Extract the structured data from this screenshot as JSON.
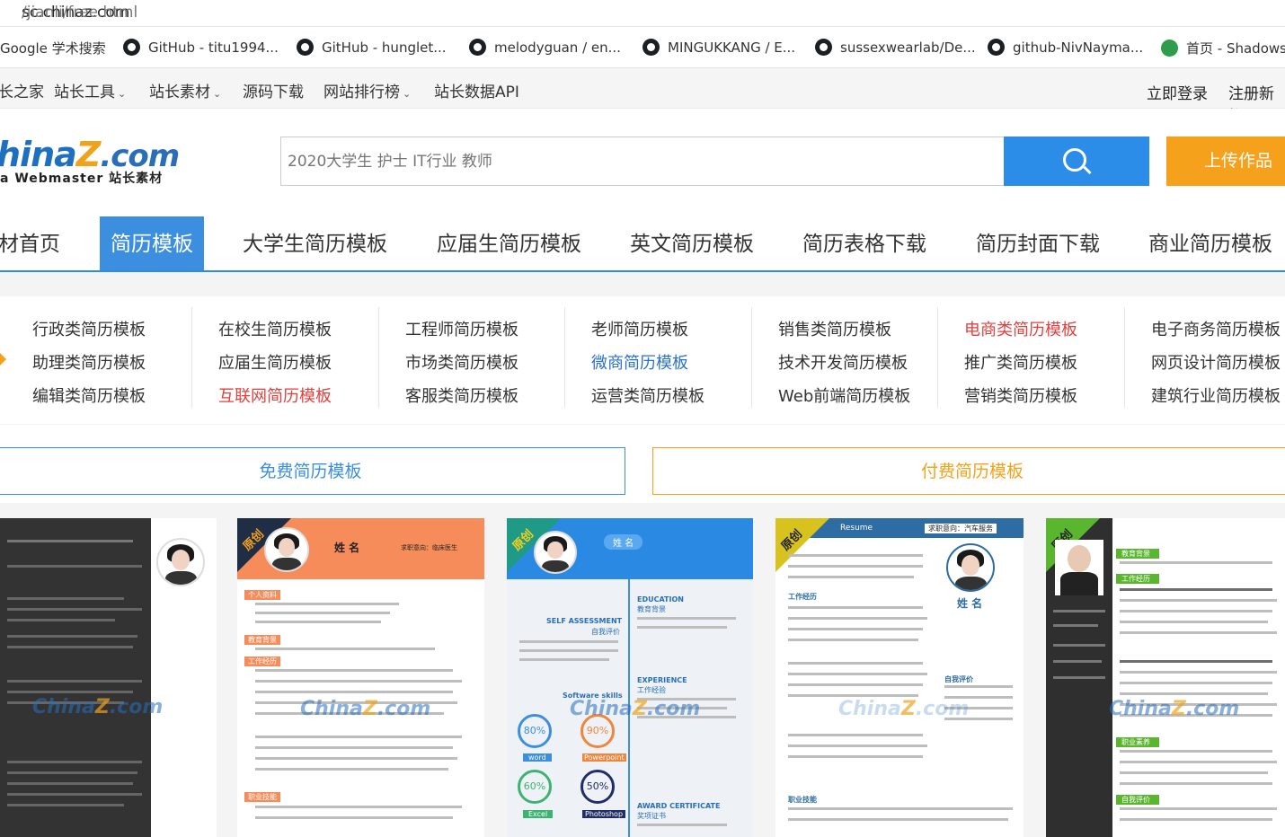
{
  "address": {
    "host": "sc.chinaz.com",
    "path": "/jianli/free.html"
  },
  "bookmarks": [
    "Google 学术搜索",
    "GitHub - titu1994...",
    "GitHub - hunglet...",
    "melodyguan / en...",
    "MINGUKKANG / E...",
    "sussexwearlab/De...",
    "github-NivNayma...",
    "首页 - Shadows"
  ],
  "topnav": {
    "items": [
      "长之家",
      "站长工具",
      "站长素材",
      "源码下载",
      "网站排行榜",
      "站长数据API"
    ],
    "login": "立即登录",
    "register": "注册新帐"
  },
  "logo": {
    "main_a": "hina",
    "main_z": "Z",
    "main_com": ".com",
    "sub": "a Webmaster 站长素材"
  },
  "search": {
    "placeholder": "2020大学生 护士 IT行业 教师",
    "upload": "上传作品"
  },
  "catnav": [
    "材首页",
    "简历模板",
    "大学生简历模板",
    "应届生简历模板",
    "英文简历模板",
    "简历表格下载",
    "简历封面下载",
    "商业简历模板"
  ],
  "subcats": [
    [
      "行政类简历模板",
      "助理类简历模板",
      "编辑类简历模板"
    ],
    [
      "在校生简历模板",
      "应届生简历模板",
      "互联网简历模板"
    ],
    [
      "工程师简历模板",
      "市场类简历模板",
      "客服类简历模板"
    ],
    [
      "老师简历模板",
      "微商简历模板",
      "运营类简历模板"
    ],
    [
      "销售类简历模板",
      "技术开发简历模板",
      "Web前端简历模板"
    ],
    [
      "电商类简历模板",
      "推广类简历模板",
      "营销类简历模板"
    ],
    [
      "电子商务简历模板",
      "网页设计简历模板",
      "建筑行业简历模板"
    ]
  ],
  "tabs": {
    "free": "免费简历模板",
    "paid": "付费简历模板"
  },
  "cards": {
    "badge": "原创",
    "watermark_a": "China",
    "watermark_z": "Z",
    "watermark_com": ".com",
    "card2": {
      "name": "姓 名",
      "intent": "求职意向：临床医生",
      "sec1": "个人资料",
      "sec2": "教育背景",
      "sec3": "工作经历",
      "sec4": "职业技能"
    },
    "card3": {
      "name": "姓 名",
      "education": "EDUCATION",
      "edu_cn": "教育背景",
      "self": "SELF ASSESSMENT",
      "self_cn": "自我评价",
      "experience": "EXPERIENCE",
      "exp_cn": "工作经验",
      "skills": "Software skills",
      "award": "AWARD CERTIFICATE",
      "award_cn": "奖项证书",
      "p1": "80%",
      "p2": "90%",
      "p3": "60%",
      "p4": "50%",
      "s1": "word",
      "s2": "Powerpoint",
      "s3": "Excel",
      "s4": "Photoshop"
    },
    "card4": {
      "title": "Resume",
      "intent": "求职意向：汽车服务",
      "name": "姓 名",
      "sec1": "工作经历",
      "sec2": "自我评价",
      "sec3": "职业技能"
    },
    "card5": {
      "sec1": "教育背景",
      "sec2": "工作经历",
      "sec3": "职业素养",
      "sec4": "自我评价"
    }
  },
  "colors": {
    "brand_blue": "#2b8de8",
    "brand_orange": "#f5a11c",
    "active_red": "#e2403c",
    "link_blue": "#2b72c7"
  }
}
